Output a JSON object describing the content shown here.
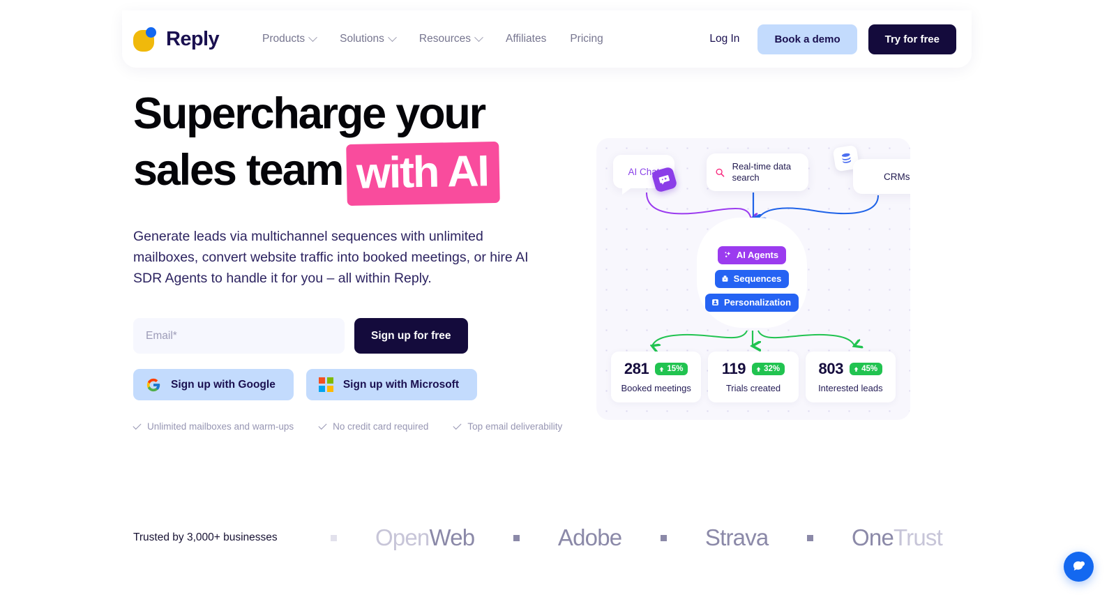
{
  "header": {
    "brand": {
      "name": "Reply",
      "logo_icon": "reply-logo-blob-dot",
      "yellow": "#F0B90B",
      "blue": "#1368F0"
    },
    "nav": [
      {
        "label": "Products",
        "has_dropdown": true
      },
      {
        "label": "Solutions",
        "has_dropdown": true
      },
      {
        "label": "Resources",
        "has_dropdown": true
      },
      {
        "label": "Affiliates",
        "has_dropdown": false
      },
      {
        "label": "Pricing",
        "has_dropdown": false
      }
    ],
    "login_label": "Log In",
    "demo_label": "Book a demo",
    "try_label": "Try for free"
  },
  "hero": {
    "headline_part1": "Supercharge your",
    "headline_part2": "sales team",
    "headline_highlight": "with AI",
    "highlight_color": "#F94C9D",
    "subhead": "Generate leads via multichannel sequences with unlimited mailboxes, convert website traffic into booked meetings, or hire AI SDR Agents to handle it for you – all within Reply.",
    "email_placeholder": "Email*",
    "email_value": "",
    "signup_label": "Sign up for free",
    "google_label": "Sign up with Google",
    "microsoft_label": "Sign up with Microsoft",
    "checks": [
      "Unlimited mailboxes and warm-ups",
      "No credit card required",
      "Top email deliverability"
    ]
  },
  "illustration": {
    "sources": [
      {
        "label": "AI Chat",
        "icon": "chat-bubble-icon",
        "color": "#8B44E8"
      },
      {
        "label": "Real-time data search",
        "icon": "search-icon",
        "color": "#F8297E"
      },
      {
        "label": "CRMs",
        "icon": "database-icon",
        "color": "#4C6FF0"
      }
    ],
    "hub_pills": [
      {
        "label": "AI Agents",
        "icon": "sparkle-icon",
        "color": "#9B3BEF"
      },
      {
        "label": "Sequences",
        "icon": "inbox-icon",
        "color": "#2563F3"
      },
      {
        "label": "Personalization",
        "icon": "contact-card-icon",
        "color": "#2563F3"
      }
    ],
    "stats": [
      {
        "value": "281",
        "delta": "15%",
        "label": "Booked meetings"
      },
      {
        "value": "119",
        "delta": "32%",
        "label": "Trials created"
      },
      {
        "value": "803",
        "delta": "45%",
        "label": "Interested leads"
      }
    ],
    "stat_badge_color": "#21C350"
  },
  "trusted": {
    "label": "Trusted by 3,000+ businesses",
    "logos": [
      {
        "name": "OpenWeb",
        "light_part": "Open",
        "dark_part": "Web"
      },
      {
        "name": "Adobe"
      },
      {
        "name": "Strava"
      },
      {
        "name": "OneTrust",
        "dark_part": "One",
        "light_part": "Trust"
      }
    ]
  },
  "widget": {
    "icon": "chat-widget-icon",
    "color": "#1368F0"
  }
}
